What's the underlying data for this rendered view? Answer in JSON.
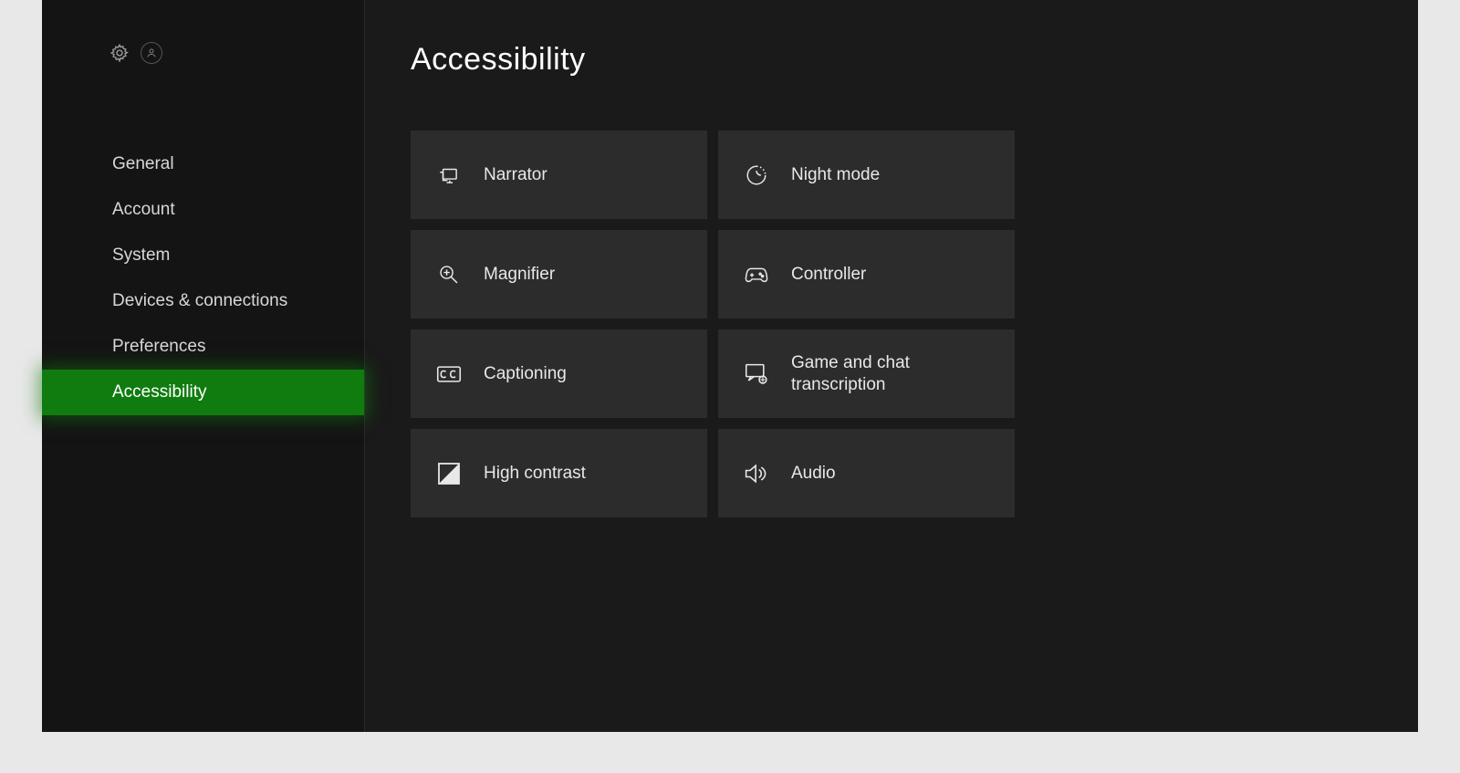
{
  "header": {
    "title": "Accessibility"
  },
  "sidebar": {
    "items": [
      {
        "label": "General"
      },
      {
        "label": "Account"
      },
      {
        "label": "System"
      },
      {
        "label": "Devices & connections"
      },
      {
        "label": "Preferences"
      },
      {
        "label": "Accessibility"
      }
    ],
    "active_index": 5
  },
  "tiles": [
    {
      "label": "Narrator",
      "icon": "narrator-icon"
    },
    {
      "label": "Night mode",
      "icon": "night-mode-icon"
    },
    {
      "label": "Magnifier",
      "icon": "magnifier-icon"
    },
    {
      "label": "Controller",
      "icon": "controller-icon"
    },
    {
      "label": "Captioning",
      "icon": "captioning-icon"
    },
    {
      "label": "Game and chat transcription",
      "icon": "transcription-icon"
    },
    {
      "label": "High contrast",
      "icon": "high-contrast-icon"
    },
    {
      "label": "Audio",
      "icon": "audio-icon"
    }
  ]
}
